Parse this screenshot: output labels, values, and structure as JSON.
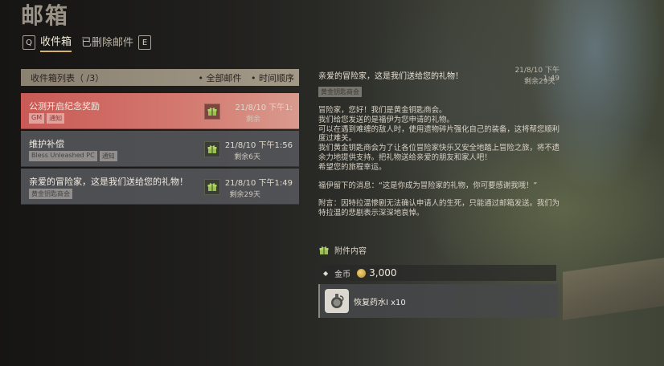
{
  "window": {
    "title": "邮箱"
  },
  "tabs": {
    "left_key": "Q",
    "inbox": "收件箱",
    "deleted": "已删除邮件",
    "right_key": "E"
  },
  "list": {
    "header_title": "收件箱列表（ /3）",
    "filter_all": "• 全部邮件",
    "sort_time": "• 时间顺序",
    "items": [
      {
        "subject": "公测开启纪念奖励",
        "tags": [
          "GM",
          "通知"
        ],
        "date": "21/8/10 下午1:",
        "remain": "剩余",
        "selected": true
      },
      {
        "subject": "维护补偿",
        "tags": [
          "Bless Unleashed PC",
          "通知"
        ],
        "date": "21/8/10 下午1:56",
        "remain": "剩余6天",
        "selected": false
      },
      {
        "subject": "亲爱的冒险家，这是我们送给您的礼物！",
        "tags": [
          "黄金钥匙商会"
        ],
        "date": "21/8/10 下午1:49",
        "remain": "剩余29天",
        "selected": false
      }
    ]
  },
  "detail": {
    "subject": "亲爱的冒险家，这是我们送给您的礼物！",
    "date": "21/8/10 下午1:49",
    "remain": "剩余29天",
    "sender": "黄金钥匙商会",
    "body": [
      "冒险家，您好！我们是黄金钥匙商会。",
      "我们给您发送的是福伊为您申请的礼物。",
      "可以在遇到难缠的敌人时，使用遗物碎片强化自己的装备，这将帮您顺利度过难关。",
      "我们黄金钥匙商会为了让各位冒险家快乐又安全地踏上冒险之旅，将不遗余力地提供支持。把礼物送给亲爱的朋友和家人吧！",
      "希望您的旅程幸运。",
      "福伊留下的消息：“这是你成为冒险家的礼物，你可要感谢我哦！”",
      "附言：因特拉温惨剧无法确认申请人的生死，只能通过邮箱发送。我们为特拉温的悲剧表示深深地哀悼。"
    ],
    "attach_label": "附件内容",
    "gold_label": "金币",
    "gold_amount": "3,000",
    "item_name": "恢复药水I x10"
  },
  "colors": {
    "selected": "#c95a56",
    "accent": "#d6b56a",
    "gift": "#7fae4a"
  },
  "icons": {
    "gift": "gift-icon",
    "coin": "gold-coin-icon",
    "potion": "potion-icon"
  }
}
